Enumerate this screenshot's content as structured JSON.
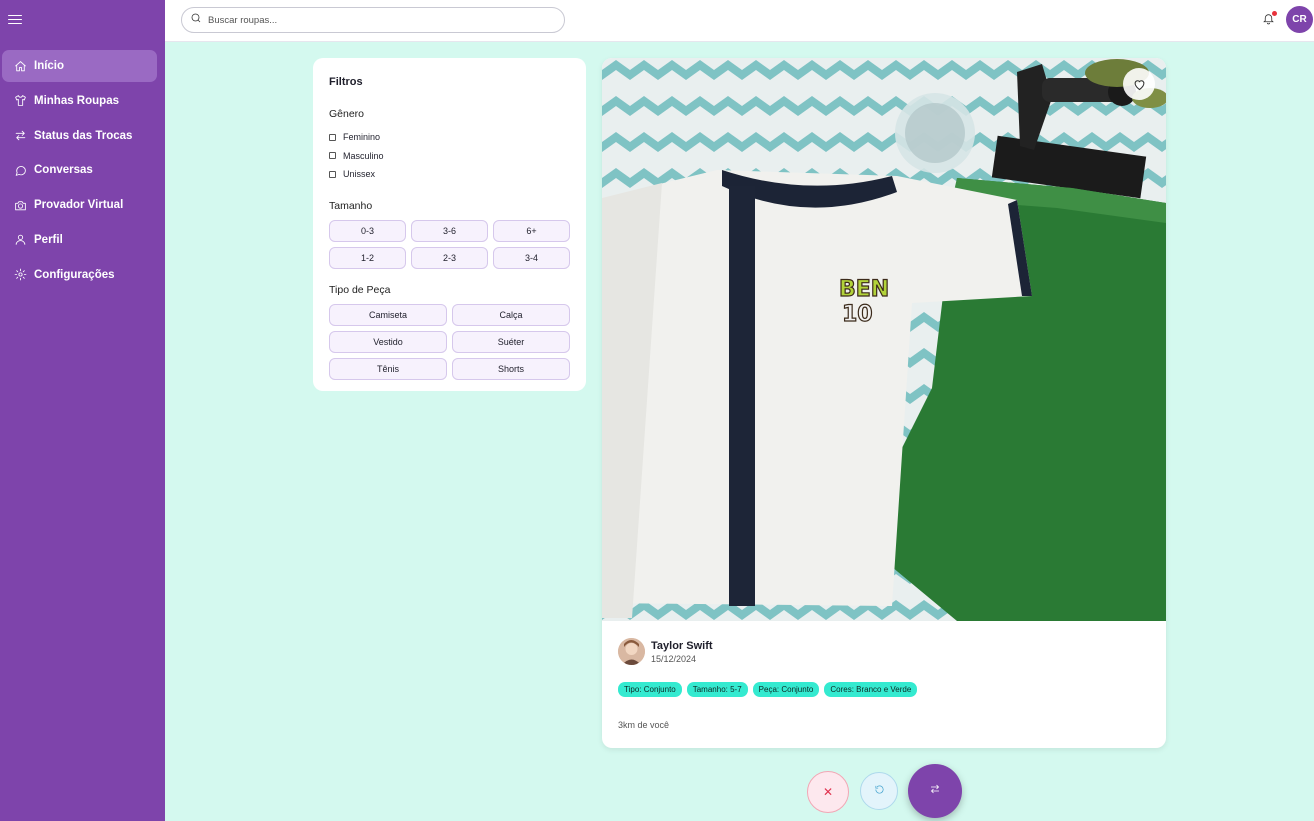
{
  "sidebar": {
    "items": [
      {
        "label": "Início",
        "icon": "home-icon",
        "active": true
      },
      {
        "label": "Minhas Roupas",
        "icon": "shirt-icon"
      },
      {
        "label": "Status das Trocas",
        "icon": "arrows-exchange-icon"
      },
      {
        "label": "Conversas",
        "icon": "chat-bubble-icon"
      },
      {
        "label": "Provador Virtual",
        "icon": "camera-icon"
      },
      {
        "label": "Perfil",
        "icon": "user-icon"
      },
      {
        "label": "Configurações",
        "icon": "gear-icon"
      }
    ]
  },
  "header": {
    "search_placeholder": "Buscar roupas...",
    "avatar_initials": "CR",
    "has_notification": true
  },
  "filters": {
    "title": "Filtros",
    "gender": {
      "label": "Gênero",
      "options": [
        "Feminino",
        "Masculino",
        "Unissex"
      ]
    },
    "size": {
      "label": "Tamanho",
      "options": [
        "0-3",
        "3-6",
        "6+",
        "1-2",
        "2-3",
        "3-4"
      ]
    },
    "type": {
      "label": "Tipo de Peça",
      "options": [
        "Camiseta",
        "Calça",
        "Vestido",
        "Suéter",
        "Tênis",
        "Shorts"
      ]
    }
  },
  "card": {
    "user_name": "Taylor Swift",
    "date": "15/12/2024",
    "tags": [
      "Tipo: Conjunto",
      "Tamanho: 5-7",
      "Peça: Conjunto",
      "Cores: Branco e Verde"
    ],
    "distance": "3km de você",
    "logo_text": [
      "BEN",
      "10"
    ]
  },
  "actions": {
    "reject_symbol": "✕"
  },
  "colors": {
    "brand": "#7e44ab",
    "background": "#d4f9ef",
    "tag": "#34ead0",
    "notification": "#e8323c"
  }
}
